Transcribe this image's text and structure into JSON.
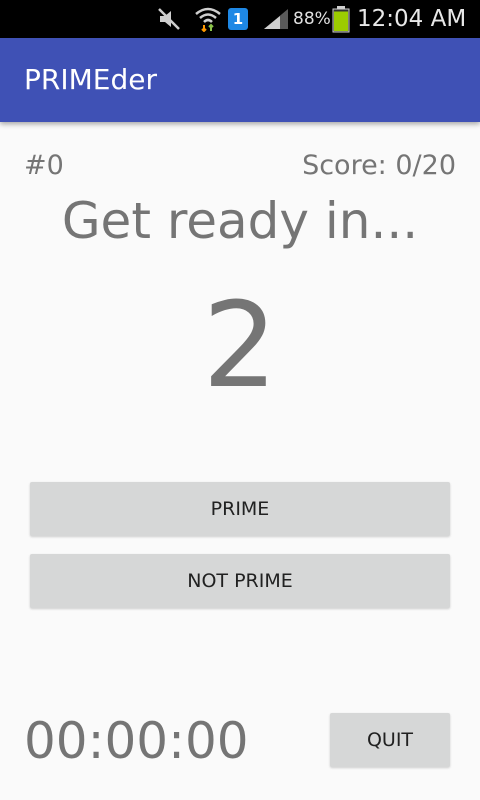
{
  "status_bar": {
    "time": "12:04 AM",
    "battery_percent": "88%",
    "notification_badge": "1",
    "icons": [
      "mute-icon",
      "wifi-icon",
      "notification-badge-icon",
      "signal-icon",
      "battery-icon"
    ],
    "battery_level": 0.88,
    "battery_color": "#9ccc00"
  },
  "app_bar": {
    "title": "PRIMEder",
    "color": "#3f51b5"
  },
  "game": {
    "counter": "#0",
    "score": "Score: 0/20",
    "ready_text": "Get ready in...",
    "countdown": "2"
  },
  "buttons": {
    "prime": "PRIME",
    "not_prime": "NOT PRIME",
    "quit": "QUIT"
  },
  "timer": {
    "value": "00:00:00"
  }
}
